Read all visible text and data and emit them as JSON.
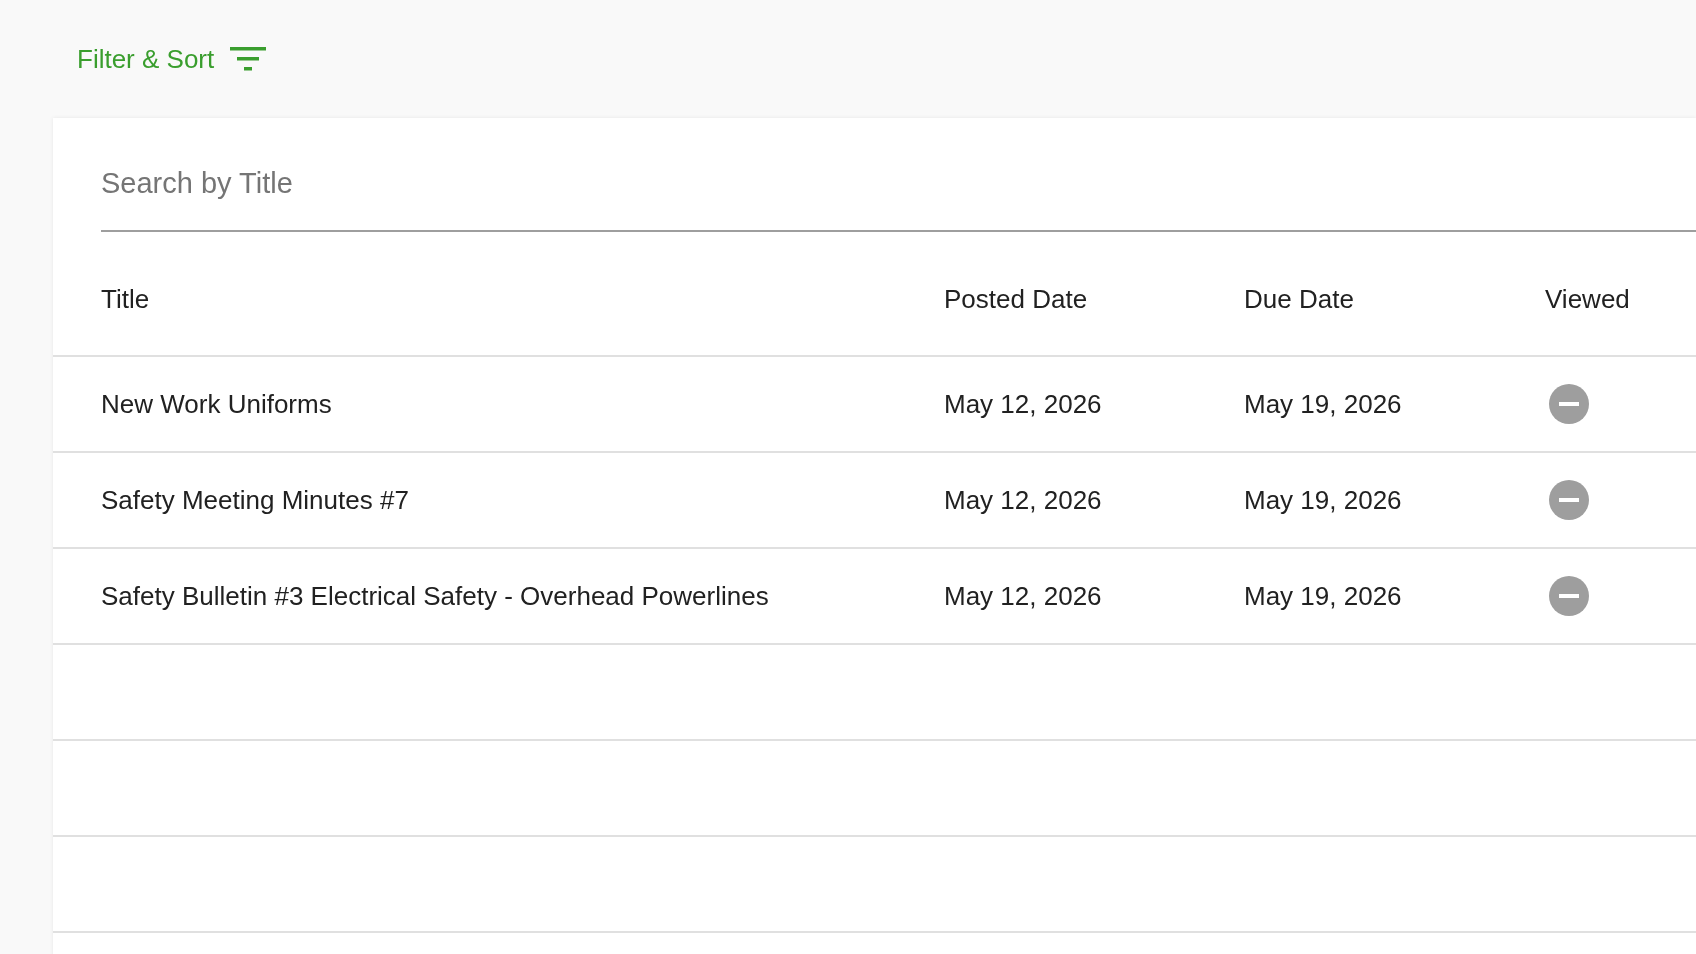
{
  "filter_button": {
    "label": "Filter & Sort"
  },
  "search": {
    "placeholder": "Search by Title"
  },
  "table": {
    "columns": [
      "Title",
      "Posted Date",
      "Due Date",
      "Viewed"
    ],
    "rows": [
      {
        "title": "New Work Uniforms",
        "posted": "May 12, 2026",
        "due": "May 19, 2026",
        "viewed": false
      },
      {
        "title": "Safety Meeting Minutes #7",
        "posted": "May 12, 2026",
        "due": "May 19, 2026",
        "viewed": false
      },
      {
        "title": "Safety Bulletin #3 Electrical Safety - Overhead Powerlines",
        "posted": "May 12, 2026",
        "due": "May 19, 2026",
        "viewed": false
      }
    ]
  }
}
